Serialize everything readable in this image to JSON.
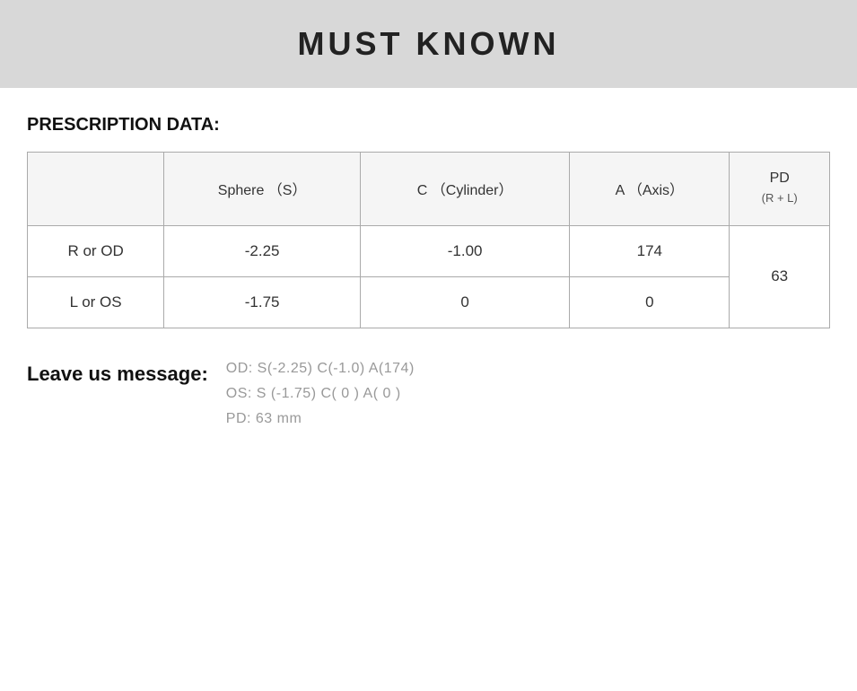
{
  "header": {
    "title": "MUST KNOWN"
  },
  "section": {
    "prescription_label": "PRESCRIPTION DATA:"
  },
  "table": {
    "headers": {
      "eye": "",
      "sphere": "Sphere （S）",
      "cylinder": "C （Cylinder）",
      "axis": "A （Axis）",
      "pd": "PD",
      "pd_sub": "(R + L)"
    },
    "rows": [
      {
        "label": "R or OD",
        "sphere": "-2.25",
        "cylinder": "-1.00",
        "axis": "174"
      },
      {
        "label": "L or OS",
        "sphere": "-1.75",
        "cylinder": "0",
        "axis": "0"
      }
    ],
    "pd_value": "63"
  },
  "message": {
    "label": "Leave us message:",
    "lines": [
      "OD:  S(-2.25)    C(-1.0)   A(174)",
      "OS:  S (-1.75)    C( 0 )    A( 0 )",
      "PD:  63 mm"
    ]
  }
}
